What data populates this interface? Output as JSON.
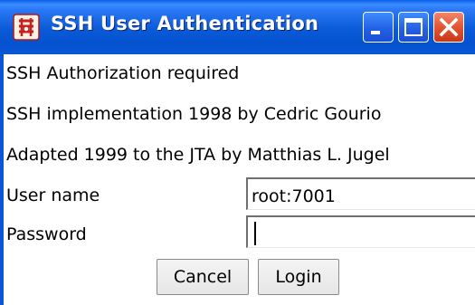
{
  "window": {
    "title": "SSH User Authentication",
    "icon": "ssh-app-icon",
    "controls": [
      "minimize-icon",
      "maximize-icon",
      "close-icon"
    ],
    "accent_color": "#0b56d8",
    "close_color": "#e1512e"
  },
  "messages": {
    "line1": "SSH Authorization required",
    "line2": "SSH implementation 1998 by Cedric Gourio",
    "line3": "Adapted 1999 to the JTA by Matthias L. Jugel"
  },
  "form": {
    "username_label": "User name",
    "username_value": "root:7001",
    "password_label": "Password",
    "password_value": ""
  },
  "buttons": {
    "cancel": "Cancel",
    "login": "Login"
  }
}
